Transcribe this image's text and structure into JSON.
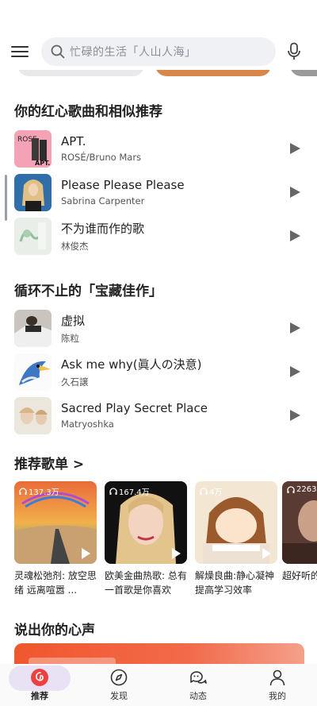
{
  "header": {
    "search_placeholder": "忙碌的生活「人山人海」"
  },
  "sections": {
    "liked": {
      "title": "你的红心歌曲和相似推荐"
    },
    "classics": {
      "title": "循环不止的「宝藏佳作」"
    },
    "playlists": {
      "title": "推荐歌单 >"
    },
    "voice": {
      "title": "说出你的心声"
    }
  },
  "liked_songs": [
    {
      "title": "APT.",
      "artist": "ROSÉ/Bruno Mars"
    },
    {
      "title": "Please Please Please",
      "artist": "Sabrina Carpenter"
    },
    {
      "title": "不为谁而作的歌",
      "artist": "林俊杰"
    }
  ],
  "classic_songs": [
    {
      "title": "虚拟",
      "artist": "陈粒"
    },
    {
      "title": "Ask me why(眞人の決意)",
      "artist": "久石譲"
    },
    {
      "title": "Sacred Play Secret Place",
      "artist": "Matryoshka"
    }
  ],
  "playlists": [
    {
      "count": "137.3万",
      "name": "灵魂松弛剂: 放空思绪 远离喧嚣 ..."
    },
    {
      "count": "167.4万",
      "name": "欧美金曲热歌: 总有一首歌是你喜欢"
    },
    {
      "count": "4万",
      "name": "解燥良曲:静心凝神提高学习效率"
    },
    {
      "count": "2263",
      "name": "超好听的(节奏控"
    }
  ],
  "nav": {
    "items": [
      {
        "label": "推荐",
        "icon": "netease-music-icon",
        "active": true
      },
      {
        "label": "发现",
        "icon": "compass-icon",
        "active": false
      },
      {
        "label": "动态",
        "icon": "chat-bubbles-icon",
        "active": false
      },
      {
        "label": "我的",
        "icon": "person-icon",
        "active": false
      }
    ]
  },
  "colors": {
    "accent": "#ec4141",
    "nav_active_bg": "#e9e2f4"
  }
}
